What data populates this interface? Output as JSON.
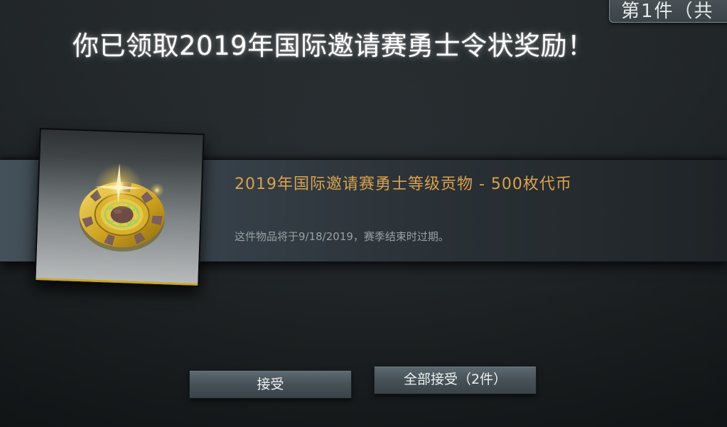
{
  "header": {
    "page_counter_fragment": "第1件（共"
  },
  "reward": {
    "headline": "你已领取2019年国际邀请赛勇士令状奖励！",
    "item_name": "2019年国际邀请赛勇士等级贡物 - 500枚代币",
    "expiry_note": "这件物品将于9/18/2019，赛季结束时过期。",
    "item_icon": "gold-token-coin-icon"
  },
  "actions": {
    "accept_label": "接受",
    "accept_all_label": "全部接受（2件）"
  },
  "colors": {
    "item_name": "#d9a24f",
    "headline": "#ffffff",
    "card_accent": "#c9a726"
  }
}
